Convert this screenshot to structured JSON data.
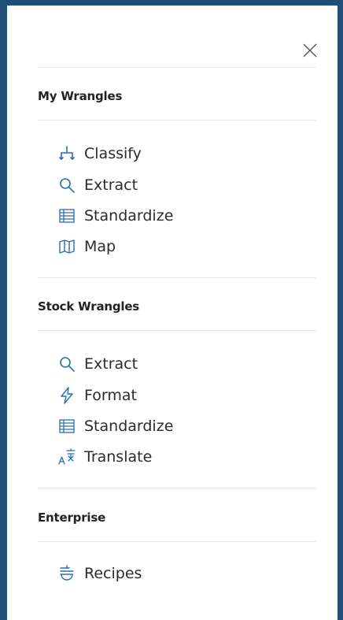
{
  "sections": [
    {
      "title": "My Wrangles",
      "items": [
        {
          "label": "Classify",
          "icon": "classify-icon"
        },
        {
          "label": "Extract",
          "icon": "search-icon"
        },
        {
          "label": "Standardize",
          "icon": "standardize-icon"
        },
        {
          "label": "Map",
          "icon": "map-icon"
        }
      ]
    },
    {
      "title": "Stock Wrangles",
      "items": [
        {
          "label": "Extract",
          "icon": "search-icon"
        },
        {
          "label": "Format",
          "icon": "lightning-icon"
        },
        {
          "label": "Standardize",
          "icon": "standardize-icon"
        },
        {
          "label": "Translate",
          "icon": "translate-icon"
        }
      ]
    },
    {
      "title": "Enterprise",
      "items": [
        {
          "label": "Recipes",
          "icon": "recipes-icon"
        }
      ]
    }
  ],
  "colors": {
    "accent": "#2b6cb0",
    "frame": "#1f4e79",
    "text": "#2b2b2b"
  }
}
